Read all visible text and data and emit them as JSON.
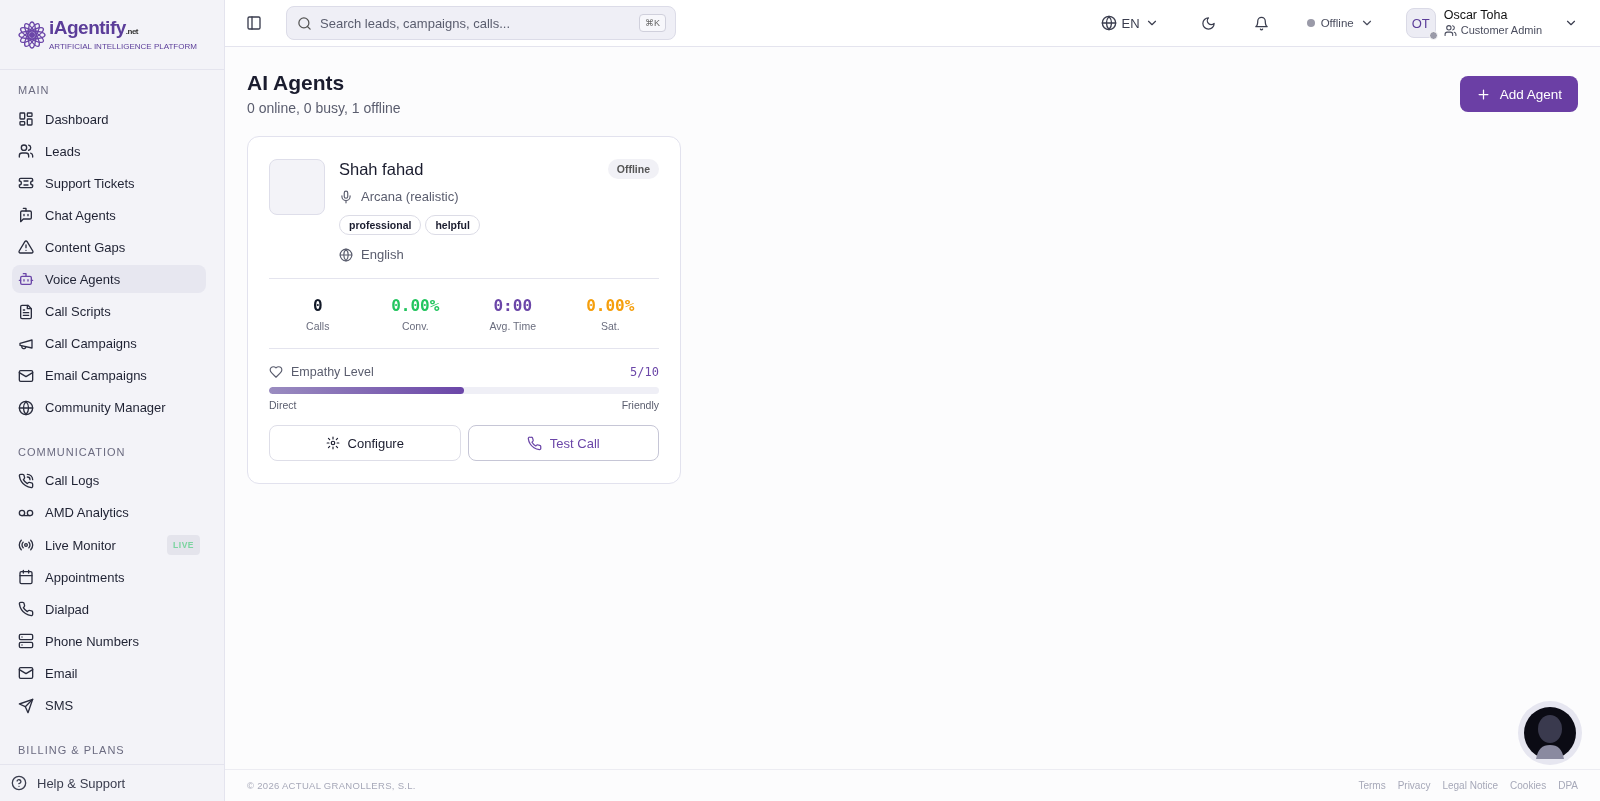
{
  "logo": {
    "name": "iAgentify",
    "suffix": ".net",
    "tagline": "ARTIFICIAL INTELLIGENCE PLATFORM"
  },
  "sidebar": {
    "sections": [
      {
        "title": "MAIN",
        "items": [
          {
            "label": "Dashboard",
            "selected": false
          },
          {
            "label": "Leads",
            "selected": false
          },
          {
            "label": "Support Tickets",
            "selected": false
          },
          {
            "label": "Chat Agents",
            "selected": false
          },
          {
            "label": "Content Gaps",
            "selected": false
          },
          {
            "label": "Voice Agents",
            "selected": true
          },
          {
            "label": "Call Scripts",
            "selected": false
          },
          {
            "label": "Call Campaigns",
            "selected": false
          },
          {
            "label": "Email Campaigns",
            "selected": false
          },
          {
            "label": "Community Manager",
            "selected": false
          }
        ]
      },
      {
        "title": "COMMUNICATION",
        "items": [
          {
            "label": "Call Logs",
            "selected": false
          },
          {
            "label": "AMD Analytics",
            "selected": false
          },
          {
            "label": "Live Monitor",
            "selected": false,
            "badge": "LIVE"
          },
          {
            "label": "Appointments",
            "selected": false
          },
          {
            "label": "Dialpad",
            "selected": false
          },
          {
            "label": "Phone Numbers",
            "selected": false
          },
          {
            "label": "Email",
            "selected": false
          },
          {
            "label": "SMS",
            "selected": false
          }
        ]
      },
      {
        "title": "BILLING & PLANS"
      }
    ],
    "help": "Help & Support"
  },
  "topbar": {
    "search": {
      "placeholder": "Search leads, campaigns, calls...",
      "shortcut": "⌘K"
    },
    "language": "EN",
    "status": "Offline",
    "user": {
      "initials": "OT",
      "name": "Oscar Toha",
      "role": "Customer Admin"
    }
  },
  "page": {
    "title": "AI Agents",
    "subtitle": "0 online, 0 busy, 1 offline",
    "add_button": "Add Agent"
  },
  "agents": [
    {
      "name": "Shah fahad",
      "status": "Offline",
      "voice": "Arcana (realistic)",
      "tags": [
        "professional",
        "helpful"
      ],
      "language": "English",
      "stats": [
        {
          "value": "0",
          "label": "Calls",
          "color": "#111827"
        },
        {
          "value": "0.00%",
          "label": "Conv.",
          "color": "#22c55e"
        },
        {
          "value": "0:00",
          "label": "Avg. Time",
          "color": "#6b46a8"
        },
        {
          "value": "0.00%",
          "label": "Sat.",
          "color": "#f59e0b"
        }
      ],
      "empathy": {
        "label": "Empathy Level",
        "reading": "5/10",
        "level": 0.5,
        "low": "Direct",
        "high": "Friendly"
      },
      "buttons": [
        {
          "label": "Configure",
          "kind": "plain"
        },
        {
          "label": "Test Call",
          "kind": "accent"
        }
      ]
    }
  ],
  "footer": {
    "copyright": "© 2026 ACTUAL GRANOLLERS, S.L.",
    "links": [
      "Terms",
      "Privacy",
      "Legal Notice",
      "Cookies",
      "DPA"
    ]
  }
}
